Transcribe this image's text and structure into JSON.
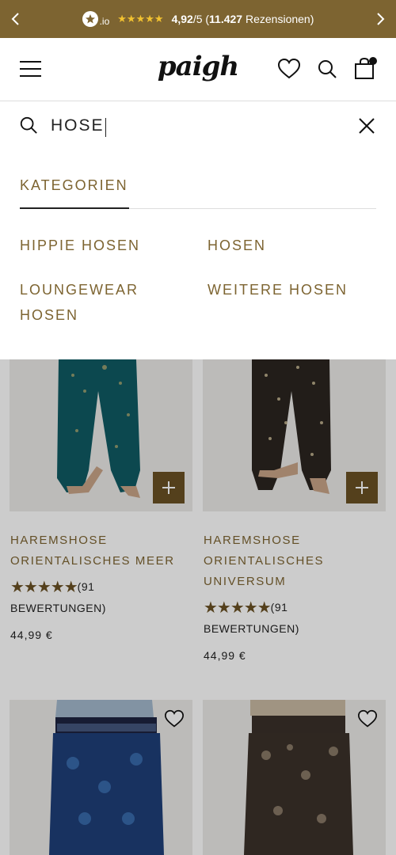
{
  "banner": {
    "brand_suffix": ".io",
    "stars": "★★★★★",
    "score": "4,92",
    "score_suffix": "/5 (",
    "review_count": "11.427",
    "review_word": " Rezensionen)"
  },
  "header": {
    "logo": "paigh"
  },
  "search": {
    "query": "HOSE"
  },
  "categories": {
    "title": "KATEGORIEN",
    "items": [
      {
        "label": "HIPPIE HOSEN"
      },
      {
        "label": "HOSEN"
      },
      {
        "label": "LOUNGEWEAR\nHOSEN"
      },
      {
        "label": "WEITERE HOSEN"
      }
    ]
  },
  "products": [
    {
      "title": "HAREMSHOSE\nORIENTALISCHES MEER",
      "rating_stars": "★★★★★",
      "rating_count": "(91",
      "rating_word": "BEWERTUNGEN)",
      "price": "44,99 €"
    },
    {
      "title": "HAREMSHOSE\nORIENTALISCHES\nUNIVERSUM",
      "rating_stars": "★★★★★",
      "rating_count": "(91",
      "rating_word": "BEWERTUNGEN)",
      "price": "44,99 €"
    }
  ],
  "colors": {
    "banner_bg": "#7d6431",
    "accent_text": "#7d6431",
    "add_button": "#6a5024",
    "banner_stars": "#f2c230"
  },
  "icons": {
    "banner_left": "chevron-left-icon",
    "banner_right": "chevron-right-icon",
    "menu": "hamburger-menu-icon",
    "wishlist": "heart-icon",
    "search": "search-icon",
    "cart": "shopping-bag-icon",
    "close": "close-icon",
    "add": "plus-icon"
  }
}
